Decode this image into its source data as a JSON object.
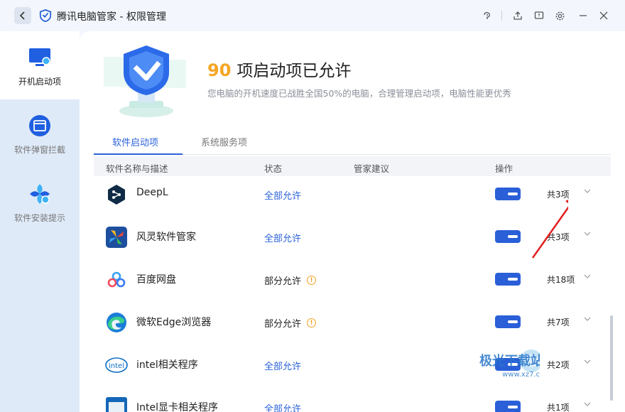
{
  "window": {
    "title": "腾讯电脑管家 - 权限管理",
    "back_icon": "chevron-left-icon",
    "toolbar_icons": [
      "skin-icon",
      "share-icon",
      "feedback-icon",
      "settings-icon",
      "minimize-icon",
      "close-icon"
    ]
  },
  "sidebar": {
    "items": [
      {
        "label": "开机启动项",
        "icon": "monitor-icon",
        "active": true
      },
      {
        "label": "软件弹窗拦截",
        "icon": "popup-block-icon",
        "active": false
      },
      {
        "label": "软件安装提示",
        "icon": "install-prompt-icon",
        "active": false
      }
    ]
  },
  "hero": {
    "count": "90",
    "title": "项启动项已允许",
    "subtitle": "您电脑的开机速度已战胜全国50%的电脑，合理管理启动项，电脑性能更优秀"
  },
  "tabs": [
    {
      "label": "软件启动项",
      "active": true
    },
    {
      "label": "系统服务项",
      "active": false
    }
  ],
  "table": {
    "headers": {
      "name": "软件名称与描述",
      "status": "状态",
      "advice": "管家建议",
      "action": "操作"
    },
    "rows": [
      {
        "name": "DeepL",
        "status": "全部允许",
        "partial": false,
        "enabled": true,
        "count": "共3项",
        "icon": "deepl-icon"
      },
      {
        "name": "风灵软件管家",
        "status": "全部允许",
        "partial": false,
        "enabled": true,
        "count": "共3项",
        "icon": "fengling-icon"
      },
      {
        "name": "百度网盘",
        "status": "部分允许",
        "partial": true,
        "enabled": true,
        "count": "共18项",
        "icon": "baidu-netdisk-icon"
      },
      {
        "name": "微软Edge浏览器",
        "status": "部分允许",
        "partial": true,
        "enabled": true,
        "count": "共7项",
        "icon": "edge-icon"
      },
      {
        "name": "intel相关程序",
        "status": "全部允许",
        "partial": false,
        "enabled": true,
        "count": "共2项",
        "icon": "intel-icon"
      },
      {
        "name": "Intel显卡相关程序",
        "status": "全部允许",
        "partial": false,
        "enabled": true,
        "count": "共1项",
        "icon": "intel-graphics-icon"
      }
    ]
  },
  "colors": {
    "accent": "#2a62d8",
    "highlight": "#f5a623",
    "warning": "#f0a020",
    "annotation_arrow": "#e02020"
  },
  "watermark": {
    "text": "极光下载站",
    "url_text": "www.xz7.com"
  }
}
